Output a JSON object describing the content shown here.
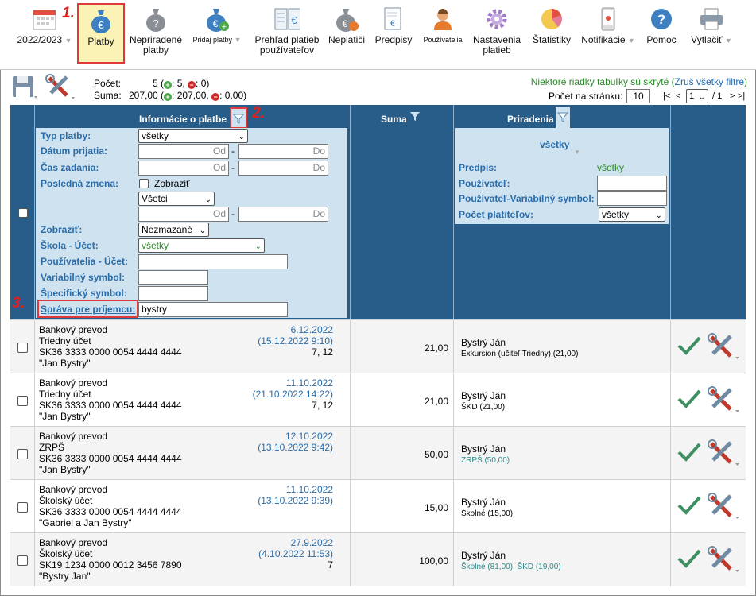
{
  "toolbar": {
    "items": [
      {
        "label": "2022/2023",
        "icon": "calendar-icon"
      },
      {
        "label": "Platby",
        "icon": "money-bag-euro-icon"
      },
      {
        "label": "Nepriradené platby",
        "icon": "money-bag-question-icon"
      },
      {
        "label": "Pridaj platby",
        "icon": "money-bag-add-icon"
      },
      {
        "label": "Prehľad platieb používateľov",
        "icon": "euro-ledger-icon"
      },
      {
        "label": "Neplatiči",
        "icon": "money-bag-clock-icon"
      },
      {
        "label": "Predpisy",
        "icon": "document-euro-icon"
      },
      {
        "label": "Používatelia",
        "icon": "user-icon"
      },
      {
        "label": "Nastavenia platieb",
        "icon": "gear-icon"
      },
      {
        "label": "Štatistiky",
        "icon": "pie-chart-icon"
      },
      {
        "label": "Notifikácie",
        "icon": "phone-icon"
      },
      {
        "label": "Pomoc",
        "icon": "help-icon"
      },
      {
        "label": "Vytlačiť",
        "icon": "printer-icon"
      }
    ],
    "step1": "1.",
    "step2": "2.",
    "step3": "3."
  },
  "summary": {
    "count_label": "Počet:",
    "count_value": "5 (",
    "count_plus": "5",
    "count_minus": "0",
    "sum_label": "Suma:",
    "sum_value": "207,00 (",
    "sum_plus": "207,00",
    "sum_minus": "0.00",
    "hidden_rows_text": "Niektoré riadky tabuľky sú skryté",
    "reset_filters": "Zruš všetky filtre",
    "per_page_label": "Počet na stránku:",
    "per_page_value": "10",
    "page_first": "|<",
    "page_prev": "<",
    "page_current": "1",
    "page_sep": "/ 1",
    "page_next": ">",
    "page_last": ">|"
  },
  "columns": {
    "info": "Informácie o platbe",
    "sum": "Suma",
    "assign": "Priradenia"
  },
  "filters": {
    "typ_label": "Typ platby:",
    "typ_value": "všetky",
    "datum_label": "Dátum prijatia:",
    "cas_label": "Čas zadania:",
    "from_ph": "Od",
    "to_ph": "Do",
    "posledna_label": "Posledná zmena:",
    "zobrazit_cb": "Zobraziť",
    "vsetci": "Všetci",
    "zobrazit_label": "Zobraziť:",
    "zobrazit_value": "Nezmazané",
    "skola_label": "Škola - Účet:",
    "skola_value": "všetky",
    "pouz_label": "Používatelia - Účet:",
    "vs_label": "Variabilný symbol:",
    "ss_label": "Špecifický symbol:",
    "sprava_label": "Správa pre príjemcu:",
    "sprava_value": "bystry",
    "assign_all": "všetky",
    "predpis_label": "Predpis:",
    "predpis_value": "všetky",
    "pouzivatel_label": "Používateľ:",
    "pvs_label": "Používateľ-Variabilný symbol:",
    "pocet_label": "Počet platiteľov:",
    "pocet_value": "všetky"
  },
  "rows": [
    {
      "type": "Bankový prevod",
      "account": "Triedny účet",
      "iban": "SK36 3333 0000 0054 4444 4444",
      "msg": "\"Jan Bystry\"",
      "date": "6.12.2022",
      "date2": "(15.12.2022 9:10)",
      "vs": "7, 12",
      "sum": "21,00",
      "name": "Bystrý Ján",
      "detail": "Exkursion (učiteľ Triedny) (21,00)",
      "detail_color": "black"
    },
    {
      "type": "Bankový prevod",
      "account": "Triedny účet",
      "iban": "SK36 3333 0000 0054 4444 4444",
      "msg": "\"Jan Bystry\"",
      "date": "11.10.2022",
      "date2": "(21.10.2022 14:22)",
      "vs": "7, 12",
      "sum": "21,00",
      "name": "Bystrý Ján",
      "detail": "ŠKD (21,00)",
      "detail_color": "black"
    },
    {
      "type": "Bankový prevod",
      "account": "ZRPŠ",
      "iban": "SK36 3333 0000 0054 4444 4444",
      "msg": "\"Jan Bystry\"",
      "date": "12.10.2022",
      "date2": "(13.10.2022 9:42)",
      "vs": "",
      "sum": "50,00",
      "name": "Bystrý Ján",
      "detail": "ZRPŠ (50,00)",
      "detail_color": "teal"
    },
    {
      "type": "Bankový prevod",
      "account": "Školský účet",
      "iban": "SK36 3333 0000 0054 4444 4444",
      "msg": "\"Gabriel a Jan Bystry\"",
      "date": "11.10.2022",
      "date2": "(13.10.2022 9:39)",
      "vs": "",
      "sum": "15,00",
      "name": "Bystrý Ján",
      "detail": "Školné (15,00)",
      "detail_color": "black"
    },
    {
      "type": "Bankový prevod",
      "account": "Školský účet",
      "iban": "SK19 1234 0000 0012 3456 7890",
      "msg": "\"Bystry Jan\"",
      "date": "27.9.2022",
      "date2": "(4.10.2022 11:53)",
      "vs": "7",
      "sum": "100,00",
      "name": "Bystrý Ján",
      "detail": "Školné (81,00), ŠKD (19,00)",
      "detail_color": "teal"
    }
  ]
}
